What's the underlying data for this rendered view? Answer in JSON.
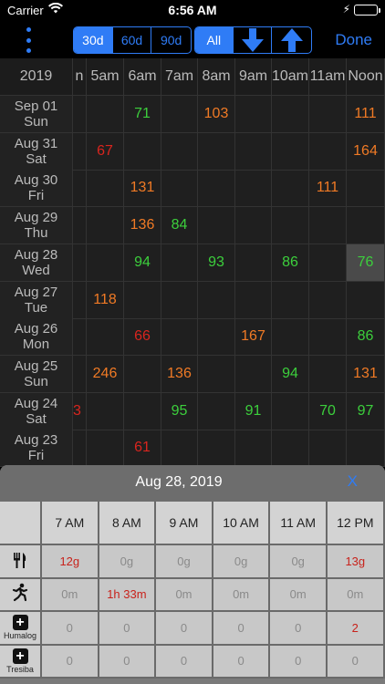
{
  "status": {
    "carrier": "Carrier",
    "time": "6:56 AM"
  },
  "toolbar": {
    "range_options": [
      "30d",
      "60d",
      "90d"
    ],
    "range_selected": 0,
    "sort_all": "All",
    "done_label": "Done"
  },
  "grid": {
    "year": "2019",
    "partial_left_header": "n",
    "hours": [
      "5am",
      "6am",
      "7am",
      "8am",
      "9am",
      "10am",
      "11am",
      "Noon"
    ],
    "rows": [
      {
        "date": "Sep 01",
        "day": "Sun",
        "values": [
          "",
          "71",
          "",
          "103",
          "",
          "",
          "",
          "111"
        ],
        "colors": [
          "",
          "g",
          "",
          "o",
          "",
          "",
          "",
          "o"
        ],
        "edge": ""
      },
      {
        "date": "Aug 31",
        "day": "Sat",
        "values": [
          "67",
          "",
          "",
          "",
          "",
          "",
          "",
          "164"
        ],
        "colors": [
          "r",
          "",
          "",
          "",
          "",
          "",
          "",
          "o"
        ],
        "edge": ""
      },
      {
        "date": "Aug 30",
        "day": "Fri",
        "values": [
          "",
          "131",
          "",
          "",
          "",
          "",
          "111",
          ""
        ],
        "colors": [
          "",
          "o",
          "",
          "",
          "",
          "",
          "o",
          ""
        ],
        "edge": ""
      },
      {
        "date": "Aug 29",
        "day": "Thu",
        "values": [
          "",
          "136",
          "84",
          "",
          "",
          "",
          "",
          ""
        ],
        "colors": [
          "",
          "o",
          "g",
          "",
          "",
          "",
          "",
          ""
        ],
        "edge": ""
      },
      {
        "date": "Aug 28",
        "day": "Wed",
        "values": [
          "",
          "94",
          "",
          "93",
          "",
          "86",
          "",
          "76"
        ],
        "colors": [
          "",
          "g",
          "",
          "g",
          "",
          "g",
          "",
          "g"
        ],
        "edge": "",
        "highlight": 7
      },
      {
        "date": "Aug 27",
        "day": "Tue",
        "values": [
          "118",
          "",
          "",
          "",
          "",
          "",
          "",
          ""
        ],
        "colors": [
          "o",
          "",
          "",
          "",
          "",
          "",
          "",
          ""
        ],
        "edge": ""
      },
      {
        "date": "Aug 26",
        "day": "Mon",
        "values": [
          "",
          "66",
          "",
          "",
          "167",
          "",
          "",
          "86"
        ],
        "colors": [
          "",
          "r",
          "",
          "",
          "o",
          "",
          "",
          "g"
        ],
        "edge": ""
      },
      {
        "date": "Aug 25",
        "day": "Sun",
        "values": [
          "246",
          "",
          "136",
          "",
          "",
          "94",
          "",
          "131"
        ],
        "colors": [
          "o",
          "",
          "o",
          "",
          "",
          "g",
          "",
          "o"
        ],
        "edge": ""
      },
      {
        "date": "Aug 24",
        "day": "Sat",
        "values": [
          "",
          "",
          "95",
          "",
          "91",
          "",
          "70",
          "97"
        ],
        "colors": [
          "",
          "",
          "g",
          "",
          "g",
          "",
          "g",
          "g"
        ],
        "edge": "3"
      },
      {
        "date": "Aug 23",
        "day": "Fri",
        "values": [
          "",
          "61",
          "",
          "",
          "",
          "",
          "",
          ""
        ],
        "colors": [
          "",
          "r",
          "",
          "",
          "",
          "",
          "",
          ""
        ],
        "edge": ""
      }
    ]
  },
  "detail": {
    "title": "Aug 28, 2019",
    "close_label": "X",
    "hours": [
      "7 AM",
      "8 AM",
      "9 AM",
      "10 AM",
      "11 AM",
      "12 PM"
    ],
    "rows": [
      {
        "icon": "fork-knife-icon",
        "label": "",
        "values": [
          "12g",
          "0g",
          "0g",
          "0g",
          "0g",
          "13g"
        ]
      },
      {
        "icon": "running-person-icon",
        "label": "",
        "values": [
          "0m",
          "1h 33m",
          "0m",
          "0m",
          "0m",
          "0m"
        ]
      },
      {
        "icon": "plus-box-icon",
        "label": "Humalog",
        "values": [
          "0",
          "0",
          "0",
          "0",
          "0",
          "2"
        ]
      },
      {
        "icon": "plus-box-icon",
        "label": "Tresiba",
        "values": [
          "0",
          "0",
          "0",
          "0",
          "0",
          "0"
        ]
      }
    ]
  },
  "colors": {
    "accent": "#2f7cf6",
    "green": "#3ccf3c",
    "orange": "#f07a25",
    "red": "#d9251e"
  }
}
